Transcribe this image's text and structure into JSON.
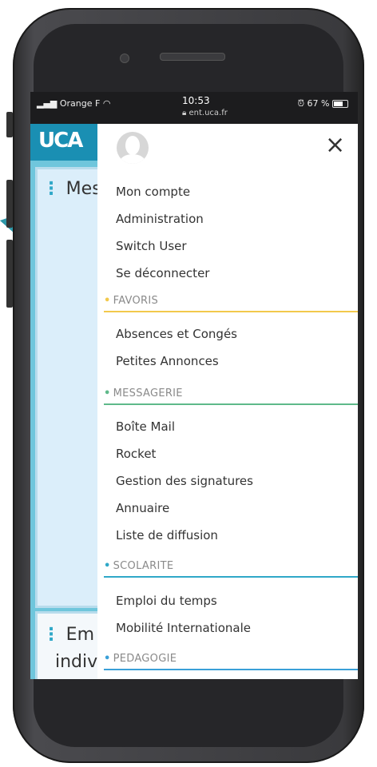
{
  "status_bar": {
    "carrier": "Orange F",
    "time": "10:53",
    "url": "ent.uca.fr",
    "battery": "67 %",
    "battery_level": 0.67
  },
  "background_page": {
    "logo": "UCA",
    "card1_title": "Mes",
    "card2_title": "Em",
    "card2_subtitle": "indiv"
  },
  "drawer": {
    "close_label": "×",
    "account_items": [
      "Mon compte",
      "Administration",
      "Switch User",
      "Se déconnecter"
    ],
    "sections": [
      {
        "title": "FAVORIS",
        "color": "#f2c94c",
        "items": [
          "Absences et Congés",
          "Petites Annonces"
        ]
      },
      {
        "title": "MESSAGERIE",
        "color": "#5fb98a",
        "items": [
          "Boîte Mail",
          "Rocket",
          "Gestion des signatures",
          "Annuaire",
          "Liste de diffusion"
        ]
      },
      {
        "title": "SCOLARITE",
        "color": "#2fa8c8",
        "items": [
          "Emploi du temps",
          "Mobilité Internationale"
        ]
      },
      {
        "title": "PEDAGOGIE",
        "color": "#3aa0d8",
        "items": []
      }
    ]
  },
  "colors": {
    "accent_teal": "#1a8fb3",
    "arrow": "#2d97a8"
  }
}
